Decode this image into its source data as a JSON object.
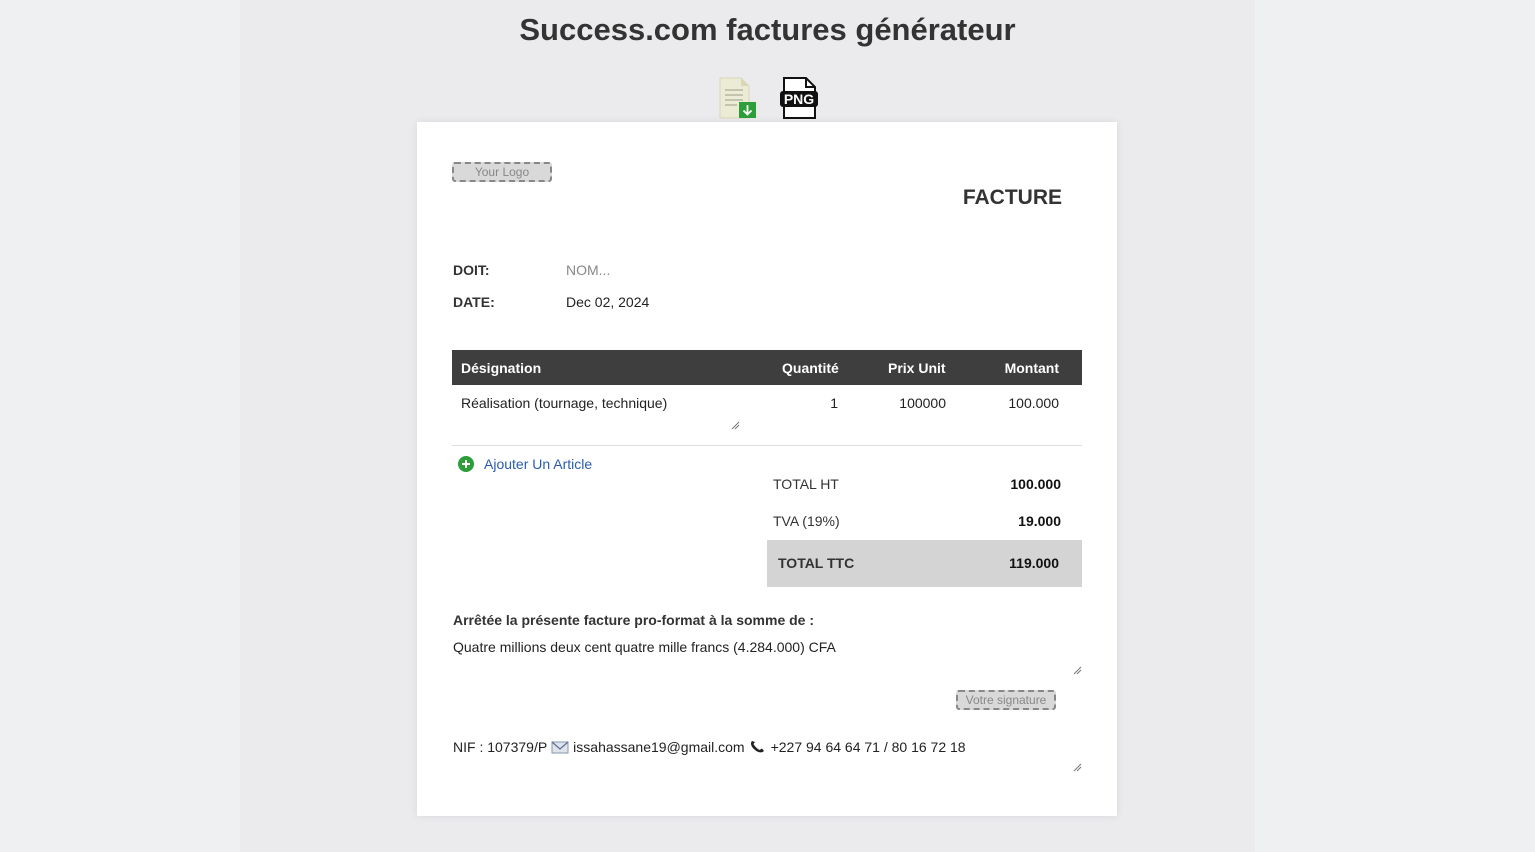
{
  "app": {
    "title": "Success.com factures générateur"
  },
  "export": {
    "doc_icon": "download-document-icon",
    "png_icon": "png-file-icon",
    "png_label": "PNG"
  },
  "invoice": {
    "logo_label": "Your Logo",
    "title": "FACTURE",
    "doit_label": "DOIT:",
    "doit_placeholder": "NOM...",
    "date_label": "DATE:",
    "date_value": "Dec 02, 2024",
    "columns": [
      "Désignation",
      "Quantité",
      "Prix Unit",
      "Montant"
    ],
    "items": [
      {
        "designation": "Réalisation (tournage, technique)",
        "quantite": "1",
        "prix_unit": "100000",
        "montant": "100.000"
      }
    ],
    "add_article_label": "Ajouter Un Article",
    "totals": {
      "ht_label": "TOTAL HT",
      "ht_value": "100.000",
      "tva_label": "TVA (19%)",
      "tva_value": "19.000",
      "ttc_label": "TOTAL TTC",
      "ttc_value": "119.000"
    },
    "sum_heading": "Arrêtée la présente facture pro-format à la somme de :",
    "sum_text": "Quatre millions deux cent quatre mille francs (4.284.000) CFA",
    "signature_label": "Votre signature",
    "footer": {
      "nif": "NIF : 107379/P",
      "email": "issahassane19@gmail.com",
      "phone": "+227 94 64 64 71 / 80 16 72 18"
    }
  }
}
